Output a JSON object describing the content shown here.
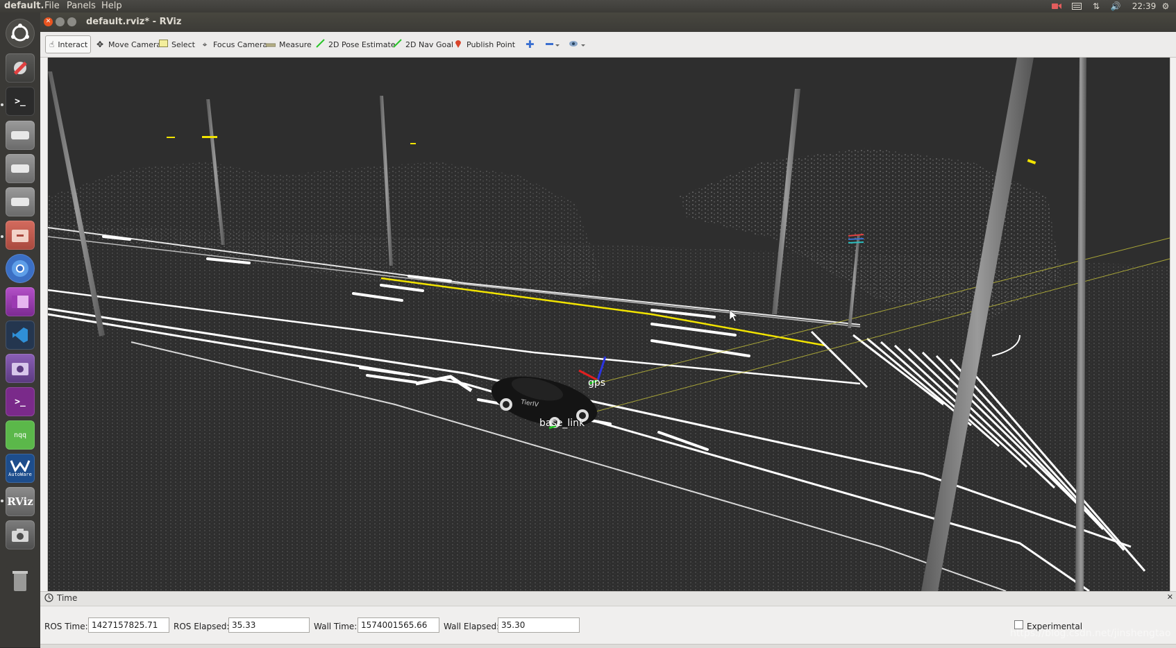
{
  "topbar": {
    "app_name": "default.",
    "menus": [
      "File",
      "Panels",
      "Help"
    ],
    "clock": "22:39"
  },
  "launcher": {
    "items": [
      "ubuntu-dash",
      "system-settings",
      "terminal",
      "disk-1",
      "disk-2",
      "disk-3",
      "file-manager",
      "chromium",
      "app-purple",
      "vscode",
      "screenshot-app",
      "terminal-2",
      "nqq",
      "AutoWare",
      "RViz",
      "camera",
      "trash"
    ],
    "nqq_label": "nqq",
    "autoware_label": "AutoWare",
    "rviz_label": "RViz"
  },
  "window": {
    "title": "default.rviz* - RViz"
  },
  "toolbar": {
    "interact": "Interact",
    "move_camera": "Move Camera",
    "select": "Select",
    "focus_camera": "Focus Camera",
    "measure": "Measure",
    "pose_estimate": "2D Pose Estimate",
    "nav_goal": "2D Nav Goal",
    "publish_point": "Publish Point"
  },
  "viewport": {
    "frame_labels": {
      "gps": "gps",
      "base_link": "base_link"
    },
    "car_text": "TierIV"
  },
  "time_panel": {
    "title": "Time",
    "ros_time_label": "ROS Time:",
    "ros_time": "1427157825.71",
    "ros_elapsed_label": "ROS Elapsed:",
    "ros_elapsed": "35.33",
    "wall_time_label": "Wall Time:",
    "wall_time": "1574001565.66",
    "wall_elapsed_label": "Wall Elapsed:",
    "wall_elapsed": "35.30",
    "experimental_label": "Experimental"
  },
  "watermark": "https://blog.csdn.net/jinshengtao",
  "colors": {
    "ubuntu_panel": "#3c3b37",
    "viewport_bg": "#2e2e2e",
    "lane_white": "#ffffff",
    "lane_yellow": "#f2e400"
  }
}
